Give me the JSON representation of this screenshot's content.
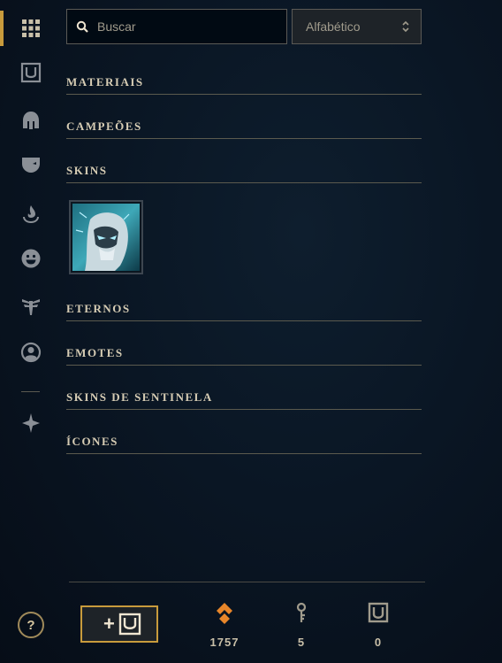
{
  "sidebar": {
    "items": [
      {
        "icon": "grid-icon",
        "active": true
      },
      {
        "icon": "rp-shield-icon",
        "active": false
      },
      {
        "icon": "champion-helmet-icon",
        "active": false
      },
      {
        "icon": "skin-mask-icon",
        "active": false
      },
      {
        "icon": "eternals-flame-icon",
        "active": false
      },
      {
        "icon": "emote-face-icon",
        "active": false
      },
      {
        "icon": "ward-icon",
        "active": false
      },
      {
        "icon": "profile-icon",
        "active": false
      },
      {
        "icon": "loot-crafting-icon",
        "active": false
      }
    ]
  },
  "search": {
    "placeholder": "Buscar",
    "value": ""
  },
  "sort": {
    "selected": "Alfabético"
  },
  "categories": [
    {
      "label": "MATERIAIS"
    },
    {
      "label": "CAMPEÕES"
    },
    {
      "label": "SKINS"
    },
    {
      "label": "ETERNOS"
    },
    {
      "label": "EMOTES"
    },
    {
      "label": "SKINS DE SENTINELA"
    },
    {
      "label": "ÍCONES"
    }
  ],
  "skins": [
    {
      "icon": "skin-portrait"
    }
  ],
  "footer": {
    "help_label": "?",
    "buy_rp_label": "+",
    "currencies": [
      {
        "icon": "orange-essence-icon",
        "value": "1757",
        "color": "#e8862a"
      },
      {
        "icon": "key-icon",
        "value": "5",
        "color": "#a09b8c"
      },
      {
        "icon": "riot-points-icon",
        "value": "0",
        "color": "#a09b8c"
      }
    ]
  },
  "colors": {
    "accent": "#c89b3c",
    "text": "#c8bfa8",
    "divider": "#5b5a4e"
  }
}
